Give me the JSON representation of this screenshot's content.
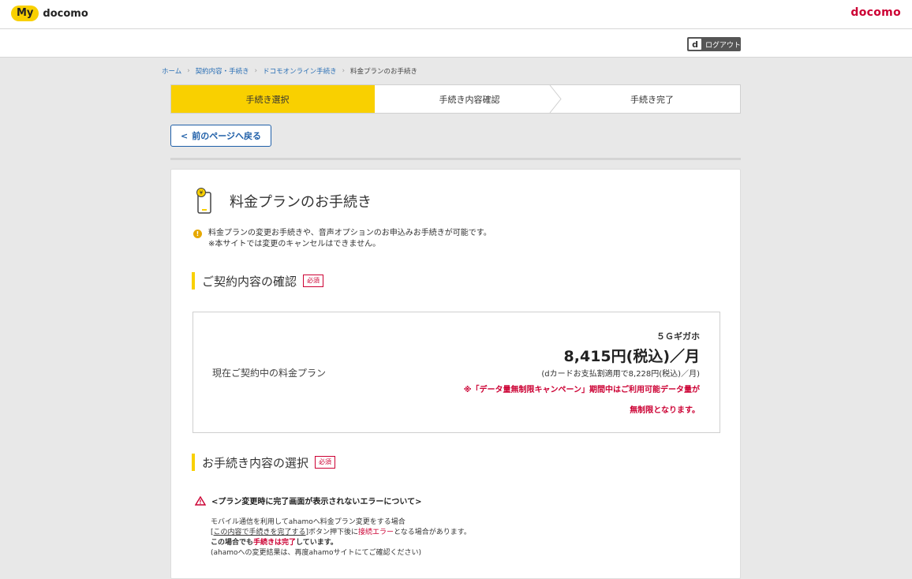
{
  "header": {
    "my": "My",
    "docomo": "docomo",
    "logo": "docomo"
  },
  "logout": {
    "d": "d",
    "label": "ログアウト"
  },
  "breadcrumb": [
    "ホーム",
    "契約内容・手続き",
    "ドコモオンライン手続き",
    "料金プランのお手続き"
  ],
  "steps": [
    "手続き選択",
    "手続き内容確認",
    "手続き完了"
  ],
  "back_button": "前のページへ戻る",
  "page_title": "料金プランのお手続き",
  "info": {
    "line1": "料金プランの変更お手続きや、音声オプションのお申込みお手続きが可能です。",
    "line2": "※本サイトでは変更のキャンセルはできません。"
  },
  "section1": {
    "label": "ご契約内容の確認",
    "badge": "必須"
  },
  "plan": {
    "label": "現在ご契約中の料金プラン",
    "name": "５Ｇギガホ",
    "price": "8,415円(税込)／月",
    "discount": "(dカードお支払割適用で8,228円(税込)／月)",
    "note": "※「データ量無制限キャンペーン」期間中はご利用可能データ量が無制限となります。"
  },
  "section2": {
    "label": "お手続き内容の選択",
    "badge": "必須"
  },
  "warning": {
    "title": "<プラン変更時に完了画面が表示されないエラーについて>",
    "l1": "モバイル通信を利用してahamoへ料金プラン変更をする場合",
    "l2a": "[",
    "l2b": "この内容で手続きを完了する",
    "l2c": "]ボタン押下後に",
    "l2d": "接続エラー",
    "l2e": "となる場合があります。",
    "l3a": "この場合でも",
    "l3b": "手続きは完了",
    "l3c": "しています。",
    "l4": "(ahamoへの変更結果は、再度ahamoサイトにてご確認ください)"
  },
  "colors": {
    "accent": "#f9d000",
    "brand_red": "#cc0033",
    "link_blue": "#1f5fa8"
  }
}
